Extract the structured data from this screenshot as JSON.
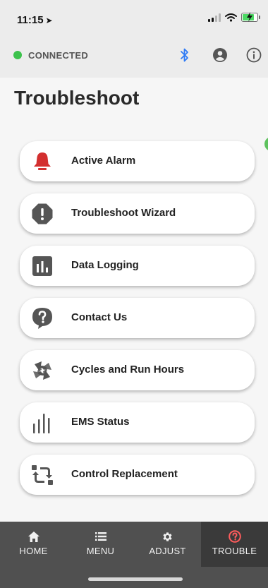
{
  "status_bar": {
    "time": "11:15",
    "location_glyph": "➤"
  },
  "app_bar": {
    "connection_status": "CONNECTED",
    "connection_color": "#3cc24c",
    "icons": [
      "bluetooth-icon",
      "user-account-icon",
      "info-icon"
    ],
    "bluetooth_color": "#2f7bf5"
  },
  "page": {
    "title": "Troubleshoot"
  },
  "menu": {
    "items": [
      {
        "label": "Active Alarm",
        "icon": "alarm-bell-icon",
        "icon_color": "#d32f2f"
      },
      {
        "label": "Troubleshoot Wizard",
        "icon": "exclamation-octagon-icon",
        "icon_color": "#555555"
      },
      {
        "label": "Data Logging",
        "icon": "bar-chart-icon",
        "icon_color": "#555555"
      },
      {
        "label": "Contact Us",
        "icon": "question-bubble-icon",
        "icon_color": "#555555"
      },
      {
        "label": "Cycles and Run Hours",
        "icon": "cycle-arrows-icon",
        "icon_color": "#555555"
      },
      {
        "label": "EMS Status",
        "icon": "signal-bars-icon",
        "icon_color": "#555555"
      },
      {
        "label": "Control Replacement",
        "icon": "swap-arrows-icon",
        "icon_color": "#555555"
      }
    ]
  },
  "tab_bar": {
    "tabs": [
      {
        "label": "HOME",
        "icon": "home-icon",
        "active": false
      },
      {
        "label": "MENU",
        "icon": "list-icon",
        "active": false
      },
      {
        "label": "ADJUST",
        "icon": "gear-icon",
        "active": false
      },
      {
        "label": "TROUBLE",
        "icon": "help-circle-icon",
        "active": true
      }
    ],
    "active_icon_color": "#ff5c5c"
  }
}
